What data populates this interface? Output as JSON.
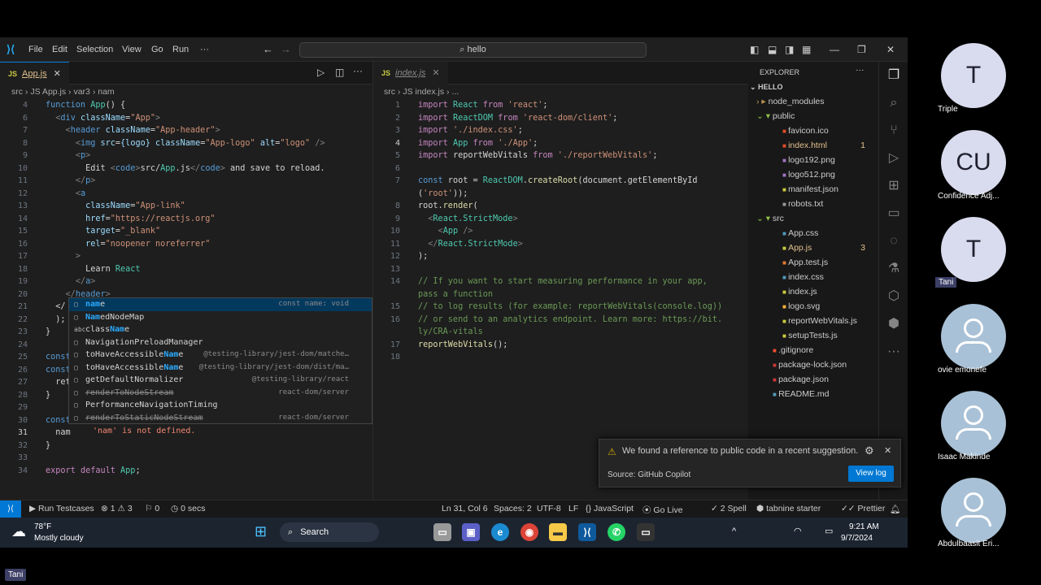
{
  "titlebar": {
    "menu": [
      "File",
      "Edit",
      "Selection",
      "View",
      "Go",
      "Run"
    ],
    "more": "···",
    "search": "hello"
  },
  "left_editor": {
    "tab": {
      "icon": "JS",
      "label": "App.js"
    },
    "breadcrumb": [
      "src",
      "JS App.js",
      "var3",
      "nam"
    ],
    "lines": [
      {
        "n": "4",
        "t": "function App() {"
      },
      {
        "n": "6",
        "t": "  <div className=\"App\">"
      },
      {
        "n": "7",
        "t": "    <header className=\"App-header\">"
      },
      {
        "n": "8",
        "t": "      <img src={logo} className=\"App-logo\" alt=\"logo\" />"
      },
      {
        "n": "9",
        "t": "      <p>"
      },
      {
        "n": "10",
        "t": "        Edit <code>src/App.js</code> and save to reload."
      },
      {
        "n": "11",
        "t": "      </p>"
      },
      {
        "n": "12",
        "t": "      <a"
      },
      {
        "n": "13",
        "t": "        className=\"App-link\""
      },
      {
        "n": "14",
        "t": "        href=\"https://reactjs.org\""
      },
      {
        "n": "15",
        "t": "        target=\"_blank\""
      },
      {
        "n": "16",
        "t": "        rel=\"noopener noreferrer\""
      },
      {
        "n": "17",
        "t": "      >"
      },
      {
        "n": "18",
        "t": "        Learn React"
      },
      {
        "n": "19",
        "t": "      </a>"
      },
      {
        "n": "20",
        "t": "    </header>"
      },
      {
        "n": "21",
        "t": "  </"
      },
      {
        "n": "22",
        "t": "  );"
      },
      {
        "n": "23",
        "t": "}"
      },
      {
        "n": "24",
        "t": ""
      },
      {
        "n": "25",
        "t": "const"
      },
      {
        "n": "26",
        "t": "const"
      },
      {
        "n": "27",
        "t": "  ret"
      },
      {
        "n": "28",
        "t": "}"
      },
      {
        "n": "29",
        "t": ""
      },
      {
        "n": "30",
        "t": "const"
      },
      {
        "n": "31",
        "t": "  nam"
      },
      {
        "n": "32",
        "t": "}"
      },
      {
        "n": "33",
        "t": ""
      },
      {
        "n": "34",
        "t": "export default App;"
      }
    ],
    "error_hint": "'nam' is not defined.",
    "suggestions": [
      {
        "label": "name",
        "detail": "const name: void"
      },
      {
        "label": "NamedNodeMap",
        "detail": ""
      },
      {
        "label": "className",
        "detail": ""
      },
      {
        "label": "NavigationPreloadManager",
        "detail": ""
      },
      {
        "label": "toHaveAccessibleName",
        "detail": "@testing-library/jest-dom/matche…"
      },
      {
        "label": "toHaveAccessibleName",
        "detail": "@testing-library/jest-dom/dist/ma…"
      },
      {
        "label": "getDefaultNormalizer",
        "detail": "@testing-library/react"
      },
      {
        "label": "renderToNodeStream",
        "detail": "react-dom/server"
      },
      {
        "label": "PerformanceNavigationTiming",
        "detail": ""
      },
      {
        "label": "renderToStaticNodeStream",
        "detail": "react-dom/server"
      }
    ]
  },
  "right_editor": {
    "tab": {
      "icon": "JS",
      "label": "index.js"
    },
    "breadcrumb": [
      "src",
      "JS index.js",
      "..."
    ],
    "lines": [
      {
        "n": "1",
        "t": "import React from 'react';"
      },
      {
        "n": "2",
        "t": "import ReactDOM from 'react-dom/client';"
      },
      {
        "n": "3",
        "t": "import './index.css';"
      },
      {
        "n": "4",
        "t": "import App from './App';"
      },
      {
        "n": "5",
        "t": "import reportWebVitals from './reportWebVitals';"
      },
      {
        "n": "6",
        "t": ""
      },
      {
        "n": "7",
        "t": "const root = ReactDOM.createRoot(document.getElementById"
      },
      {
        "n": "",
        "t": "('root'));"
      },
      {
        "n": "8",
        "t": "root.render("
      },
      {
        "n": "9",
        "t": "  <React.StrictMode>"
      },
      {
        "n": "10",
        "t": "    <App />"
      },
      {
        "n": "11",
        "t": "  </React.StrictMode>"
      },
      {
        "n": "12",
        "t": ");"
      },
      {
        "n": "13",
        "t": ""
      },
      {
        "n": "14",
        "t": "// If you want to start measuring performance in your app,"
      },
      {
        "n": "",
        "t": "pass a function"
      },
      {
        "n": "15",
        "t": "// to log results (for example: reportWebVitals(console.log))"
      },
      {
        "n": "16",
        "t": "// or send to an analytics endpoint. Learn more: https://bit."
      },
      {
        "n": "",
        "t": "ly/CRA-vitals"
      },
      {
        "n": "17",
        "t": "reportWebVitals();"
      },
      {
        "n": "18",
        "t": ""
      }
    ]
  },
  "explorer": {
    "title": "EXPLORER",
    "project": "HELLO",
    "items": [
      {
        "label": "node_modules",
        "depth": 1,
        "kind": "folder",
        "badge": ""
      },
      {
        "label": "public",
        "depth": 1,
        "kind": "folder-open",
        "badge": ""
      },
      {
        "label": "favicon.ico",
        "depth": 2,
        "kind": "file",
        "badge": ""
      },
      {
        "label": "index.html",
        "depth": 2,
        "kind": "file",
        "badge": "1"
      },
      {
        "label": "logo192.png",
        "depth": 2,
        "kind": "file",
        "badge": ""
      },
      {
        "label": "logo512.png",
        "depth": 2,
        "kind": "file",
        "badge": ""
      },
      {
        "label": "manifest.json",
        "depth": 2,
        "kind": "file",
        "badge": ""
      },
      {
        "label": "robots.txt",
        "depth": 2,
        "kind": "file",
        "badge": ""
      },
      {
        "label": "src",
        "depth": 1,
        "kind": "folder-open",
        "badge": ""
      },
      {
        "label": "App.css",
        "depth": 2,
        "kind": "file",
        "badge": ""
      },
      {
        "label": "App.js",
        "depth": 2,
        "kind": "file",
        "badge": "3"
      },
      {
        "label": "App.test.js",
        "depth": 2,
        "kind": "file",
        "badge": ""
      },
      {
        "label": "index.css",
        "depth": 2,
        "kind": "file",
        "badge": ""
      },
      {
        "label": "index.js",
        "depth": 2,
        "kind": "file",
        "badge": ""
      },
      {
        "label": "logo.svg",
        "depth": 2,
        "kind": "file",
        "badge": ""
      },
      {
        "label": "reportWebVitals.js",
        "depth": 2,
        "kind": "file",
        "badge": ""
      },
      {
        "label": "setupTests.js",
        "depth": 2,
        "kind": "file",
        "badge": ""
      },
      {
        "label": ".gitignore",
        "depth": 1,
        "kind": "file",
        "badge": ""
      },
      {
        "label": "package-lock.json",
        "depth": 1,
        "kind": "file",
        "badge": ""
      },
      {
        "label": "package.json",
        "depth": 1,
        "kind": "file",
        "badge": ""
      },
      {
        "label": "README.md",
        "depth": 1,
        "kind": "file",
        "badge": ""
      }
    ]
  },
  "notification": {
    "message": "We found a reference to public code in a recent suggestion.",
    "source": "Source: GitHub Copilot",
    "action": "View log"
  },
  "statusbar": {
    "run_testcases": "Run Testcases",
    "errors": "1",
    "warnings": "3",
    "ports": "0",
    "timer": "0 secs",
    "position": "Ln 31, Col 6",
    "spaces": "Spaces: 2",
    "encoding": "UTF-8",
    "eol": "LF",
    "language": "JavaScript",
    "golive": "Go Live",
    "spell": "2 Spell",
    "tabnine": "tabnine starter",
    "prettier": "Prettier"
  },
  "taskbar": {
    "temp": "78°F",
    "weather": "Mostly cloudy",
    "search": "Search",
    "time": "9:21 AM",
    "date": "9/7/2024"
  },
  "participants": [
    {
      "initials": "T",
      "name": "Triple",
      "has_photo": false
    },
    {
      "initials": "CU",
      "name": "Confidence Adj...",
      "has_photo": false
    },
    {
      "initials": "T",
      "name": "Tani",
      "has_photo": false
    },
    {
      "initials": "",
      "name": "ovie emonefe",
      "has_photo": true
    },
    {
      "initials": "",
      "name": "Isaac Makinde",
      "has_photo": true
    },
    {
      "initials": "",
      "name": "Abdulbaasit Eri...",
      "has_photo": true
    }
  ],
  "presenter_label": "Tani",
  "colors": {
    "accent": "#0078d4",
    "editor_bg": "#1e1e1e",
    "avatar_bg": "#d9dbee"
  }
}
